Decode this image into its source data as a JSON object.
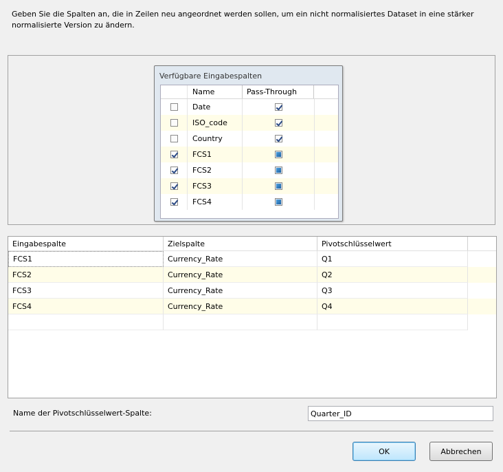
{
  "description": "Geben Sie die Spalten an, die in Zeilen neu angeordnet werden sollen, um ein nicht normalisiertes Dataset in eine stärker normalisierte Version zu ändern.",
  "available_columns": {
    "title": "Verfügbare Eingabespalten",
    "headers": {
      "name": "Name",
      "pass_through": "Pass-Through"
    },
    "rows": [
      {
        "name": "Date",
        "selected": false,
        "pass_through": "checked"
      },
      {
        "name": "ISO_code",
        "selected": false,
        "pass_through": "checked"
      },
      {
        "name": "Country",
        "selected": false,
        "pass_through": "checked"
      },
      {
        "name": "FCS1",
        "selected": true,
        "pass_through": "indeterminate"
      },
      {
        "name": "FCS2",
        "selected": true,
        "pass_through": "indeterminate"
      },
      {
        "name": "FCS3",
        "selected": true,
        "pass_through": "indeterminate"
      },
      {
        "name": "FCS4",
        "selected": true,
        "pass_through": "indeterminate"
      }
    ]
  },
  "mapping": {
    "headers": [
      "Eingabespalte",
      "Zielspalte",
      "Pivotschlüsselwert"
    ],
    "rows": [
      [
        "FCS1",
        "Currency_Rate",
        "Q1"
      ],
      [
        "FCS2",
        "Currency_Rate",
        "Q2"
      ],
      [
        "FCS3",
        "Currency_Rate",
        "Q3"
      ],
      [
        "FCS4",
        "Currency_Rate",
        "Q4"
      ]
    ]
  },
  "pivot_key": {
    "label": "Name der Pivotschlüsselwert-Spalte:",
    "value": "Quarter_ID"
  },
  "buttons": {
    "ok": "OK",
    "cancel": "Abbrechen"
  }
}
